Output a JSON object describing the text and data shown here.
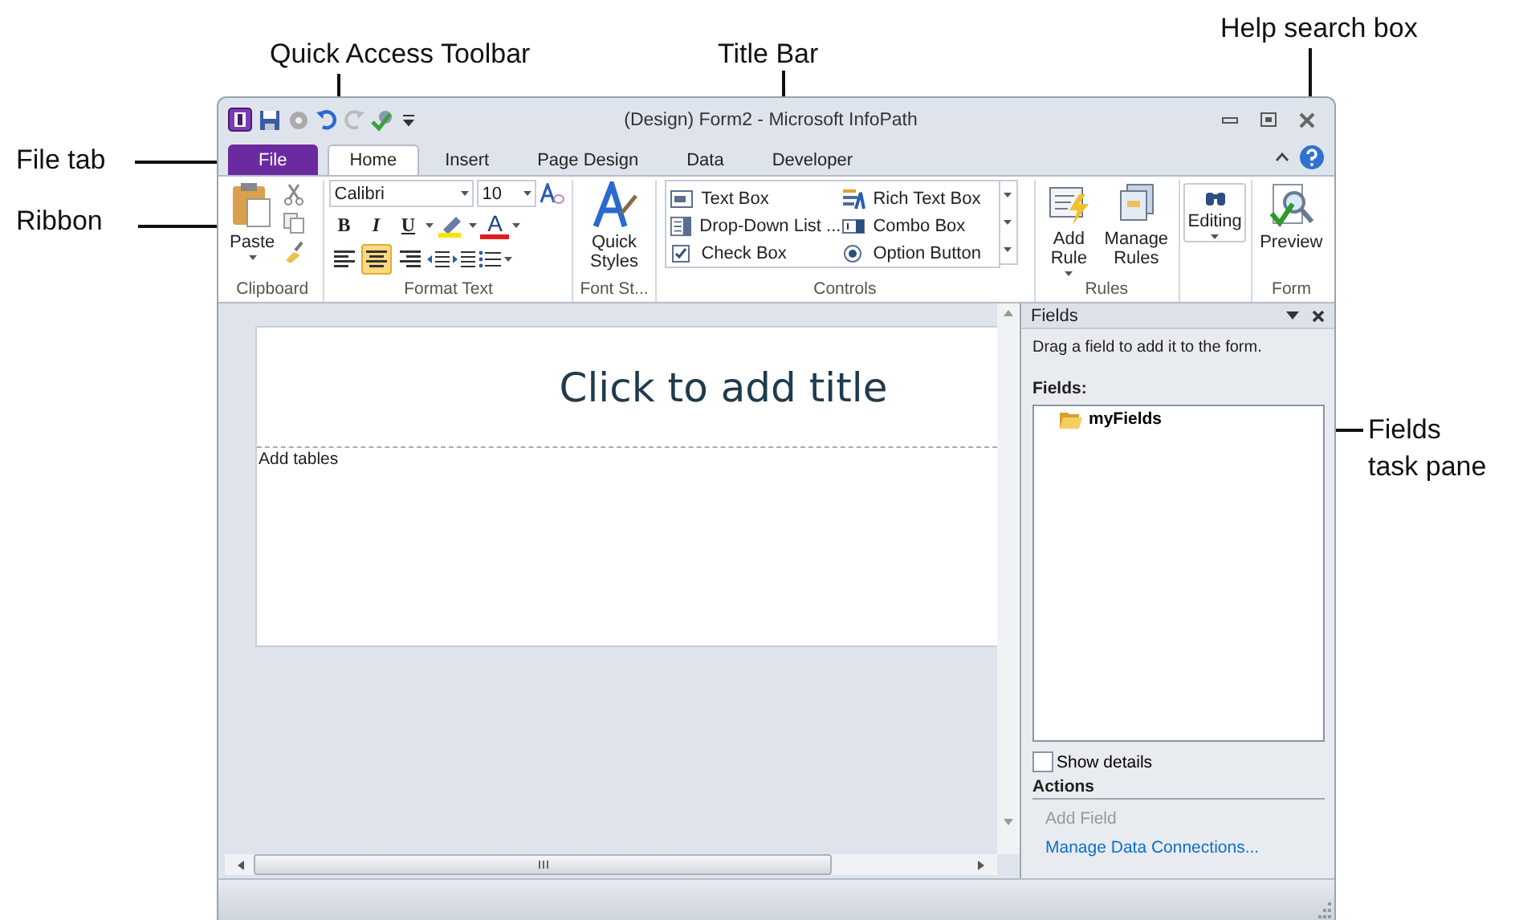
{
  "annotations": [
    {
      "kind": "qat",
      "label": "Quick Access Toolbar"
    },
    {
      "kind": "title",
      "label": "Title Bar"
    },
    {
      "kind": "help",
      "label": "Help search box"
    },
    {
      "kind": "file",
      "label": "File tab"
    },
    {
      "kind": "ribbon",
      "label": "Ribbon"
    },
    {
      "kind": "fields",
      "label": "Fields task pane"
    }
  ],
  "window": {
    "title": "(Design) Form2  -  Microsoft InfoPath"
  },
  "tabs": [
    {
      "label": "File",
      "kind": "file",
      "selected": false
    },
    {
      "label": "Home",
      "kind": "tab",
      "selected": true
    },
    {
      "label": "Insert",
      "kind": "tab",
      "selected": false
    },
    {
      "label": "Page Design",
      "kind": "tab",
      "selected": false
    },
    {
      "label": "Data",
      "kind": "tab",
      "selected": false
    },
    {
      "label": "Developer",
      "kind": "tab",
      "selected": false
    }
  ],
  "ribbon": {
    "clipboard": {
      "label": "Clipboard",
      "paste": "Paste"
    },
    "format_text": {
      "label": "Format Text",
      "font": "Calibri",
      "size": "10",
      "bold": "B",
      "italic": "I",
      "underline": "U",
      "font_color": "A",
      "alignment": [
        {
          "kind": "left",
          "selected": false
        },
        {
          "kind": "center",
          "selected": true
        },
        {
          "kind": "right",
          "selected": false
        }
      ]
    },
    "font_styles": {
      "label": "Font St...",
      "quick_styles": "Quick Styles"
    },
    "controls": {
      "label": "Controls",
      "items": [
        {
          "label": "Text Box",
          "kind": "textbox"
        },
        {
          "label": "Rich Text Box",
          "kind": "richtext"
        },
        {
          "label": "Drop-Down List ...",
          "kind": "dropdown"
        },
        {
          "label": "Combo Box",
          "kind": "combo"
        },
        {
          "label": "Check Box",
          "kind": "checkbox"
        },
        {
          "label": "Option Button",
          "kind": "option"
        }
      ]
    },
    "rules": {
      "label": "Rules",
      "add_rule": "Add Rule",
      "manage_rules": "Manage Rules"
    },
    "editing": "Editing",
    "form": {
      "label": "Form",
      "preview": "Preview"
    }
  },
  "canvas": {
    "title_placeholder": "Click to add title",
    "body": "Add tables"
  },
  "fields_pane": {
    "title": "Fields",
    "hint": "Drag a field to add it to the form.",
    "fields_label": "Fields:",
    "tree": [
      {
        "label": "myFields",
        "kind": "folder"
      }
    ],
    "show_details": {
      "label": "Show details",
      "checked": false
    },
    "actions_label": "Actions",
    "actions": [
      {
        "label": "Add Field",
        "disabled": true
      },
      {
        "label": "Manage Data Connections...",
        "disabled": false
      }
    ]
  }
}
